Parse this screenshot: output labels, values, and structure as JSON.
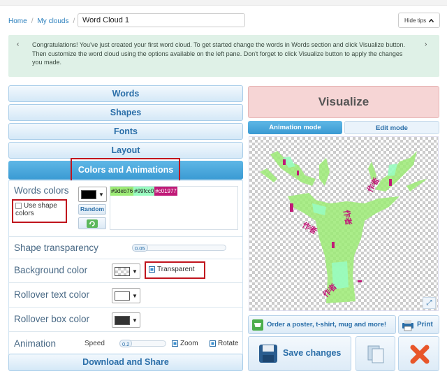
{
  "breadcrumb": {
    "home": "Home",
    "sep": "/",
    "my_clouds": "My clouds"
  },
  "cloud_name": "Word Cloud 1",
  "hide_tips": {
    "label": "Hide tips",
    "chevron": "^"
  },
  "tip": {
    "prev": "‹",
    "next": "›",
    "text": "Congratulations! You've just created your first word cloud. To get started change the words in Words section and click Visualize button. Then customize the word cloud using the options available on the left pane. Don't forget to click Visualize button to apply the changes you made."
  },
  "sections": {
    "words": "Words",
    "shapes": "Shapes",
    "fonts": "Fonts",
    "layout": "Layout",
    "colors": "Colors and Animations"
  },
  "colors_panel": {
    "words_colors_label": "Words colors",
    "use_shape_colors_label": "Use shape colors",
    "use_shape_colors_checked": false,
    "random_label": "Random",
    "color_list": [
      {
        "hex": "#9deb76",
        "label": "#9deb76"
      },
      {
        "hex": "#99fcc0",
        "label": "#99fcc0"
      },
      {
        "hex": "#c01977",
        "label": "#c01977"
      }
    ],
    "shape_transparency_label": "Shape transparency",
    "shape_transparency_value": "0.05",
    "background_color_label": "Background color",
    "transparent_label": "Transparent",
    "transparent_checked": true,
    "rollover_text_color_label": "Rollover text color",
    "rollover_box_color_label": "Rollover box color",
    "animation_label": "Animation",
    "speed_label": "Speed",
    "speed_value": "0.2",
    "zoom_label": "Zoom",
    "zoom_checked": true,
    "rotate_label": "Rotate",
    "rotate_checked": true
  },
  "download_label": "Download and Share",
  "visualize_label": "Visualize",
  "modes": {
    "animation": "Animation mode",
    "edit": "Edit mode"
  },
  "cloud_words": [
    "作者",
    "作者",
    "作者",
    "作者"
  ],
  "order_label": "Order a poster, t-shirt, mug and more!",
  "print_label": "Print",
  "save_label": "Save changes",
  "icons": {
    "hide_tips": "chevron-up-icon",
    "refresh": "refresh-icon",
    "fullscreen": "fullscreen-icon",
    "order": "shopping-icon",
    "print": "printer-icon",
    "save": "floppy-disk-icon",
    "copy": "copy-icon",
    "delete": "close-icon"
  },
  "colors": {
    "accent": "#3a9ad3",
    "highlight": "#c0141d",
    "visualize_bg": "#f6d5d5",
    "tip_bg": "#dff1e7"
  }
}
